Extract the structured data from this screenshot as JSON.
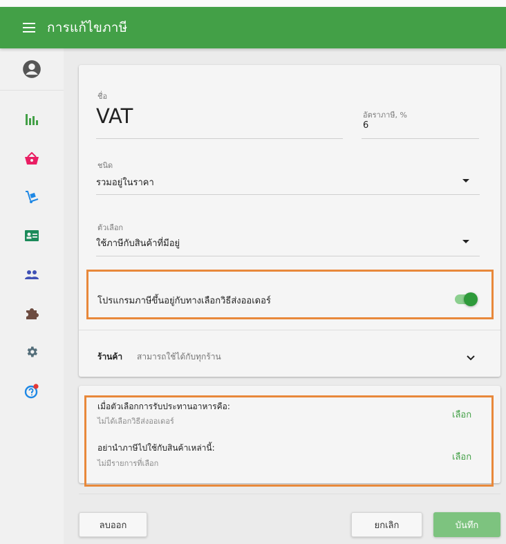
{
  "appbar": {
    "title": "การแก้ไขภาษี"
  },
  "rail": {
    "items": [
      "profile-icon",
      "chart-icon",
      "basket-icon",
      "hand-truck-icon",
      "id-card-icon",
      "people-icon",
      "puzzle-icon",
      "gear-icon",
      "help-icon"
    ]
  },
  "form": {
    "name_label": "ชื่อ",
    "name_value": "VAT",
    "rate_label": "อัตราภาษี, %",
    "rate_value": "6",
    "type_label": "ชนิด",
    "type_value": "รวมอยู่ในราคา",
    "option_label": "ตัวเลือก",
    "option_value": "ใช้ภาษีกับสินค้าที่มีอยู่",
    "toggle_label": "โปรแกรมภาษีขึ้นอยู่กับทางเลือกวิธีส่งออเดอร์",
    "toggle_on": true,
    "store_label": "ร้านค้า",
    "store_value": "สามารถใช้ได้กับทุกร้าน"
  },
  "conditions": {
    "row1_title": "เมื่อตัวเลือกการรับประทานอาหารคือ:",
    "row1_sub": "ไม่ได้เลือกวิธีส่งออเดอร์",
    "row1_action": "เลือก",
    "row2_title": "อย่านำภาษีไปใช้กับสินค้าเหล่านี้:",
    "row2_sub": "ไม่มีรายการที่เลือก",
    "row2_action": "เลือก"
  },
  "buttons": {
    "delete": "ลบออก",
    "cancel": "ยกเลิก",
    "save": "บันทึก"
  },
  "colors": {
    "brand_green": "#43a047",
    "highlight_orange": "#e8883a"
  }
}
